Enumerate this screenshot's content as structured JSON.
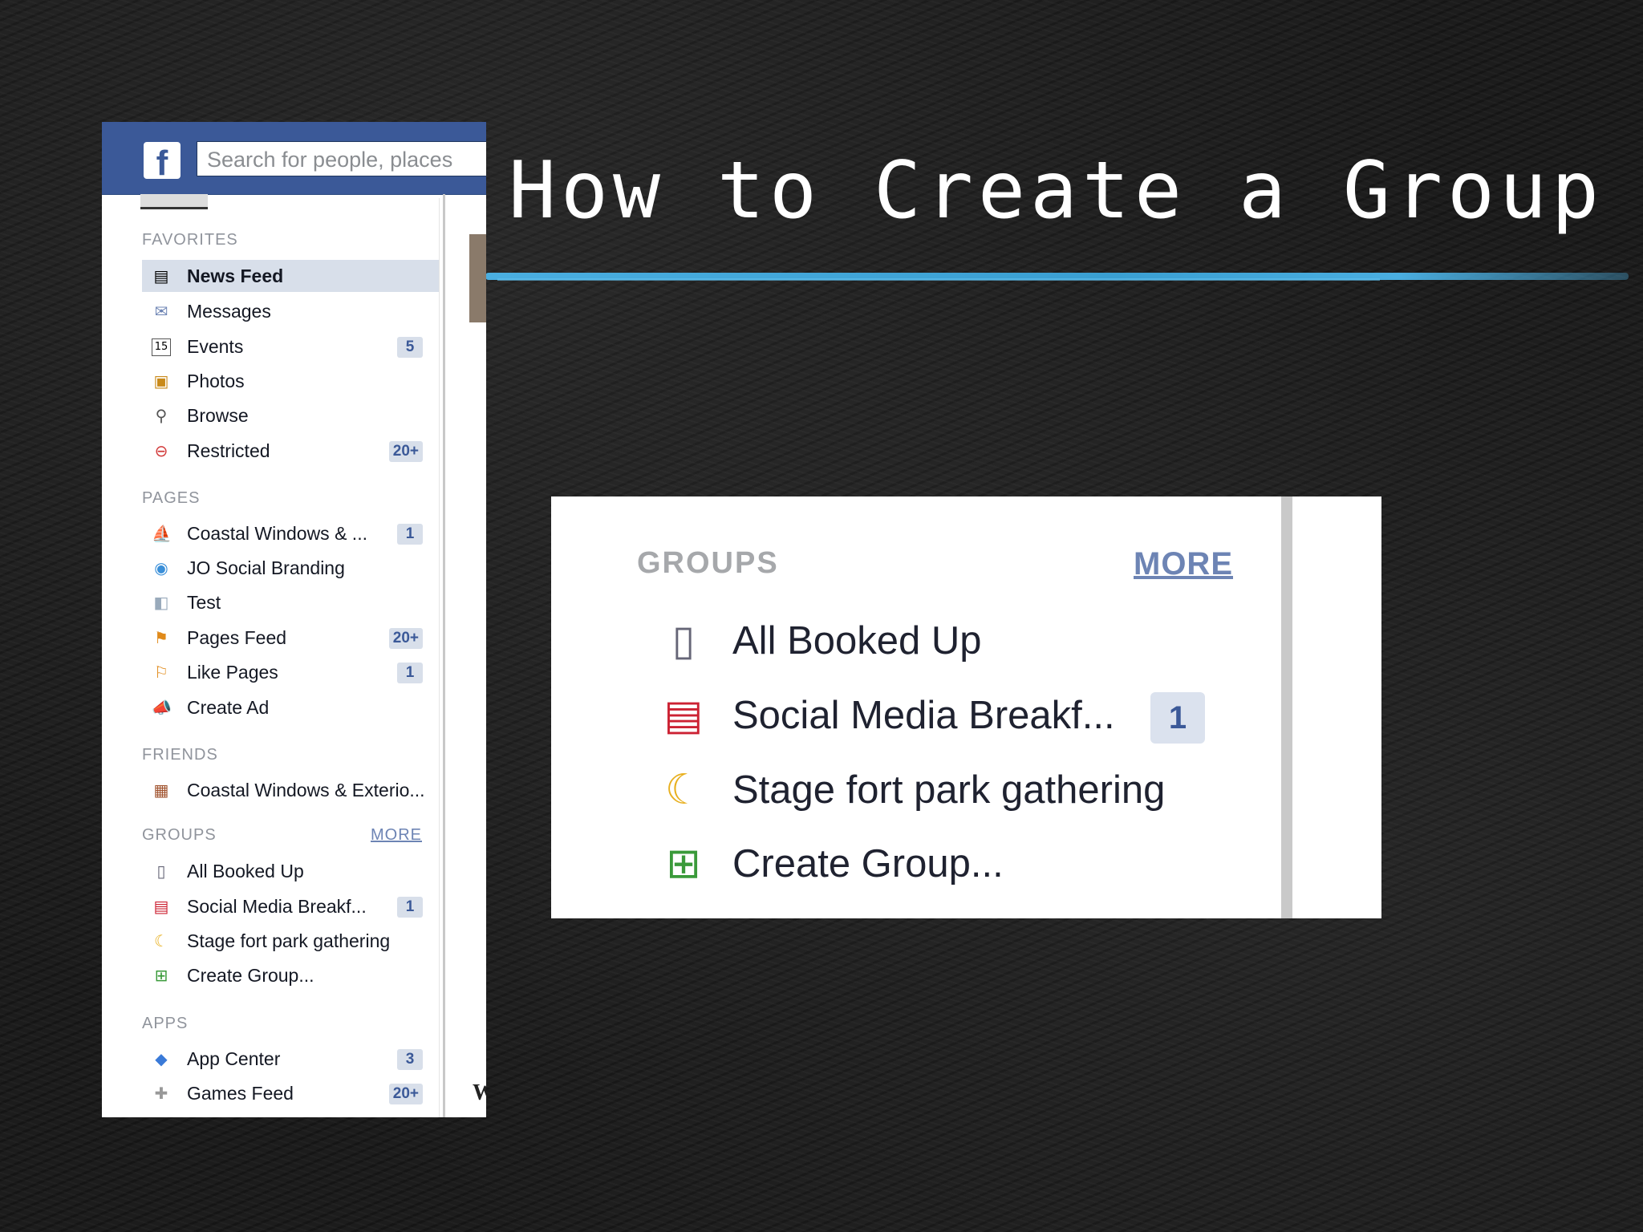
{
  "slide": {
    "title": "How to Create a Group",
    "accent_color": "#4aaee0"
  },
  "facebook": {
    "logo": "f",
    "search_placeholder": "Search for people, places",
    "favorites": {
      "heading": "FAVORITES",
      "items": [
        {
          "label": "News Feed",
          "icon": "news-feed-icon",
          "count": ""
        },
        {
          "label": "Messages",
          "icon": "messages-icon",
          "count": ""
        },
        {
          "label": "Events",
          "icon": "calendar-icon",
          "count": "5"
        },
        {
          "label": "Photos",
          "icon": "photos-icon",
          "count": ""
        },
        {
          "label": "Browse",
          "icon": "search-icon",
          "count": ""
        },
        {
          "label": "Restricted",
          "icon": "restricted-icon",
          "count": "20+"
        }
      ]
    },
    "pages": {
      "heading": "PAGES",
      "items": [
        {
          "label": "Coastal Windows & ...",
          "icon": "page-icon",
          "count": "1"
        },
        {
          "label": "JO Social Branding",
          "icon": "globe-icon",
          "count": ""
        },
        {
          "label": "Test",
          "icon": "page-blank-icon",
          "count": ""
        },
        {
          "label": "Pages Feed",
          "icon": "pages-feed-icon",
          "count": "20+"
        },
        {
          "label": "Like Pages",
          "icon": "like-pages-icon",
          "count": "1"
        },
        {
          "label": "Create Ad",
          "icon": "create-ad-icon",
          "count": ""
        }
      ]
    },
    "friends": {
      "heading": "FRIENDS",
      "items": [
        {
          "label": "Coastal Windows & Exterio...",
          "icon": "friend-list-icon",
          "count": ""
        }
      ]
    },
    "groups": {
      "heading": "GROUPS",
      "more": "MORE",
      "items": [
        {
          "label": "All Booked Up",
          "icon": "book-icon",
          "count": ""
        },
        {
          "label": "Social Media Breakf...",
          "icon": "certificate-icon",
          "count": "1"
        },
        {
          "label": "Stage fort park gathering",
          "icon": "moon-star-icon",
          "count": ""
        },
        {
          "label": "Create Group...",
          "icon": "create-group-icon",
          "count": ""
        }
      ]
    },
    "apps": {
      "heading": "APPS",
      "items": [
        {
          "label": "App Center",
          "icon": "app-center-icon",
          "count": "3"
        },
        {
          "label": "Games Feed",
          "icon": "games-icon",
          "count": "20+"
        }
      ]
    },
    "stray_letter": "W"
  },
  "zoom": {
    "heading": "GROUPS",
    "more": "MORE",
    "items": [
      {
        "label": "All Booked Up",
        "icon": "book-icon",
        "count": ""
      },
      {
        "label": "Social Media Breakf...",
        "icon": "certificate-icon",
        "count": "1"
      },
      {
        "label": "Stage fort park gathering",
        "icon": "moon-star-icon",
        "count": ""
      },
      {
        "label": "Create Group...",
        "icon": "create-group-icon",
        "count": ""
      }
    ]
  }
}
